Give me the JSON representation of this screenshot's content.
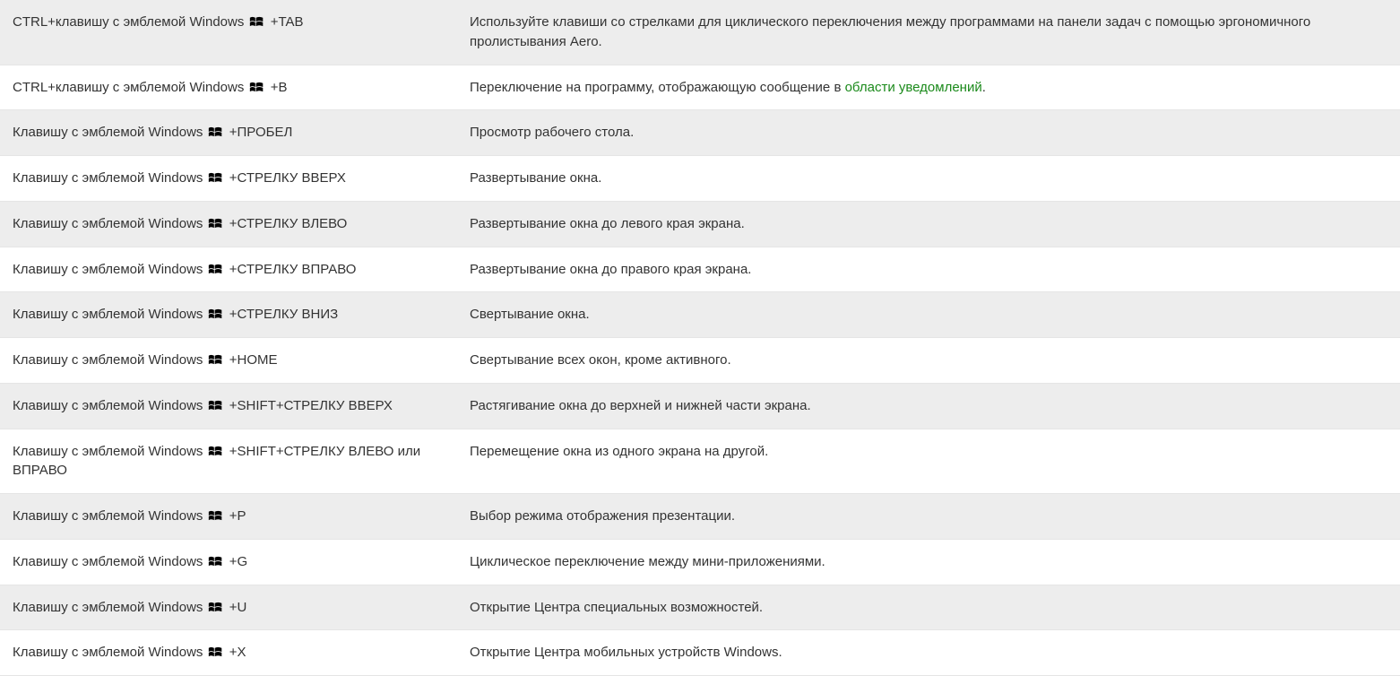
{
  "rows": [
    {
      "key_prefix": "CTRL+клавишу с эмблемой Windows",
      "key_suffix": "+TAB",
      "has_win_icon": true,
      "desc_before": "Используйте клавиши со стрелками для циклического переключения между программами на панели задач с помощью эргономичного пролистывания Aero.",
      "desc_link": "",
      "desc_after": ""
    },
    {
      "key_prefix": "CTRL+клавишу с эмблемой Windows",
      "key_suffix": "+B",
      "has_win_icon": true,
      "desc_before": "Переключение на программу, отображающую сообщение в ",
      "desc_link": "области уведомлений",
      "desc_after": "."
    },
    {
      "key_prefix": "Клавишу с эмблемой Windows",
      "key_suffix": "+ПРОБЕЛ",
      "has_win_icon": true,
      "desc_before": "Просмотр рабочего стола.",
      "desc_link": "",
      "desc_after": ""
    },
    {
      "key_prefix": "Клавишу с эмблемой Windows",
      "key_suffix": "+СТРЕЛКУ ВВЕРХ",
      "has_win_icon": true,
      "desc_before": "Развертывание окна.",
      "desc_link": "",
      "desc_after": ""
    },
    {
      "key_prefix": "Клавишу с эмблемой Windows",
      "key_suffix": "+СТРЕЛКУ ВЛЕВО",
      "has_win_icon": true,
      "desc_before": "Развертывание окна до левого края экрана.",
      "desc_link": "",
      "desc_after": ""
    },
    {
      "key_prefix": "Клавишу с эмблемой Windows",
      "key_suffix": "+СТРЕЛКУ ВПРАВО",
      "has_win_icon": true,
      "desc_before": "Развертывание окна до правого края экрана.",
      "desc_link": "",
      "desc_after": ""
    },
    {
      "key_prefix": "Клавишу с эмблемой Windows",
      "key_suffix": "+СТРЕЛКУ ВНИЗ",
      "has_win_icon": true,
      "desc_before": "Свертывание окна.",
      "desc_link": "",
      "desc_after": ""
    },
    {
      "key_prefix": "Клавишу с эмблемой Windows",
      "key_suffix": "+HOME",
      "has_win_icon": true,
      "desc_before": "Свертывание всех окон, кроме активного.",
      "desc_link": "",
      "desc_after": ""
    },
    {
      "key_prefix": "Клавишу с эмблемой Windows",
      "key_suffix": "+SHIFT+СТРЕЛКУ ВВЕРХ",
      "has_win_icon": true,
      "desc_before": "Растягивание окна до верхней и нижней части экрана.",
      "desc_link": "",
      "desc_after": ""
    },
    {
      "key_prefix": "Клавишу с эмблемой Windows",
      "key_suffix": "+SHIFT+СТРЕЛКУ ВЛЕВО или ВПРАВО",
      "has_win_icon": true,
      "desc_before": "Перемещение окна из одного экрана на другой.",
      "desc_link": "",
      "desc_after": ""
    },
    {
      "key_prefix": "Клавишу с эмблемой Windows",
      "key_suffix": "+P",
      "has_win_icon": true,
      "desc_before": "Выбор режима отображения презентации.",
      "desc_link": "",
      "desc_after": ""
    },
    {
      "key_prefix": "Клавишу с эмблемой Windows",
      "key_suffix": "+G",
      "has_win_icon": true,
      "desc_before": "Циклическое переключение между мини-приложениями.",
      "desc_link": "",
      "desc_after": ""
    },
    {
      "key_prefix": "Клавишу с эмблемой Windows",
      "key_suffix": "+U",
      "has_win_icon": true,
      "desc_before": "Открытие Центра специальных возможностей.",
      "desc_link": "",
      "desc_after": ""
    },
    {
      "key_prefix": "Клавишу с эмблемой Windows",
      "key_suffix": "+X",
      "has_win_icon": true,
      "desc_before": "Открытие Центра мобильных устройств Windows.",
      "desc_link": "",
      "desc_after": ""
    }
  ],
  "colors": {
    "link": "#1b8a1b",
    "row_odd": "#ededed",
    "row_even": "#ffffff",
    "border": "#e5e5e5"
  }
}
